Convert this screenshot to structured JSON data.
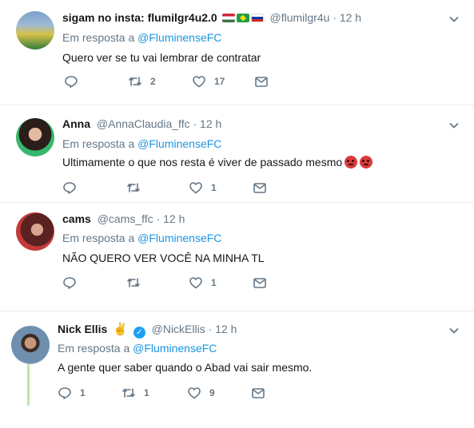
{
  "tweets": [
    {
      "name": "sigam no insta: flumilgr4u2.0",
      "handle": "@flumilgr4u",
      "time": "12 h",
      "reply_label": "Em resposta a",
      "reply_to": "@FluminenseFC",
      "text": "Quero ver se tu vai lembrar de contratar",
      "retweets": "2",
      "likes": "17",
      "replies": ""
    },
    {
      "name": "Anna",
      "handle": "@AnnaClaudia_ffc",
      "time": "12 h",
      "reply_label": "Em resposta a",
      "reply_to": "@FluminenseFC",
      "text": "Ultimamente o que nos resta é viver de passado mesmo",
      "retweets": "",
      "likes": "1",
      "replies": ""
    },
    {
      "name": "cams",
      "handle": "@cams_ffc",
      "time": "12 h",
      "reply_label": "Em resposta a",
      "reply_to": "@FluminenseFC",
      "text": "NÃO QUERO VER VOCÊ NA MINHA TL",
      "retweets": "",
      "likes": "1",
      "replies": ""
    },
    {
      "name": "Nick Ellis",
      "handle": "@NickEllis",
      "time": "12 h",
      "reply_label": "Em resposta a",
      "reply_to": "@FluminenseFC",
      "text": "A gente quer saber quando o Abad vai sair mesmo.",
      "retweets": "1",
      "likes": "9",
      "replies": "1"
    }
  ],
  "separator": "·",
  "icons": [
    "reply-icon",
    "retweet-icon",
    "like-icon",
    "dm-icon",
    "chevron-down-icon",
    "verified-icon"
  ],
  "colors": {
    "link": "#1b95e0",
    "muted": "#657786",
    "verified": "#1da1f2",
    "thread": "#c4e4a6"
  }
}
